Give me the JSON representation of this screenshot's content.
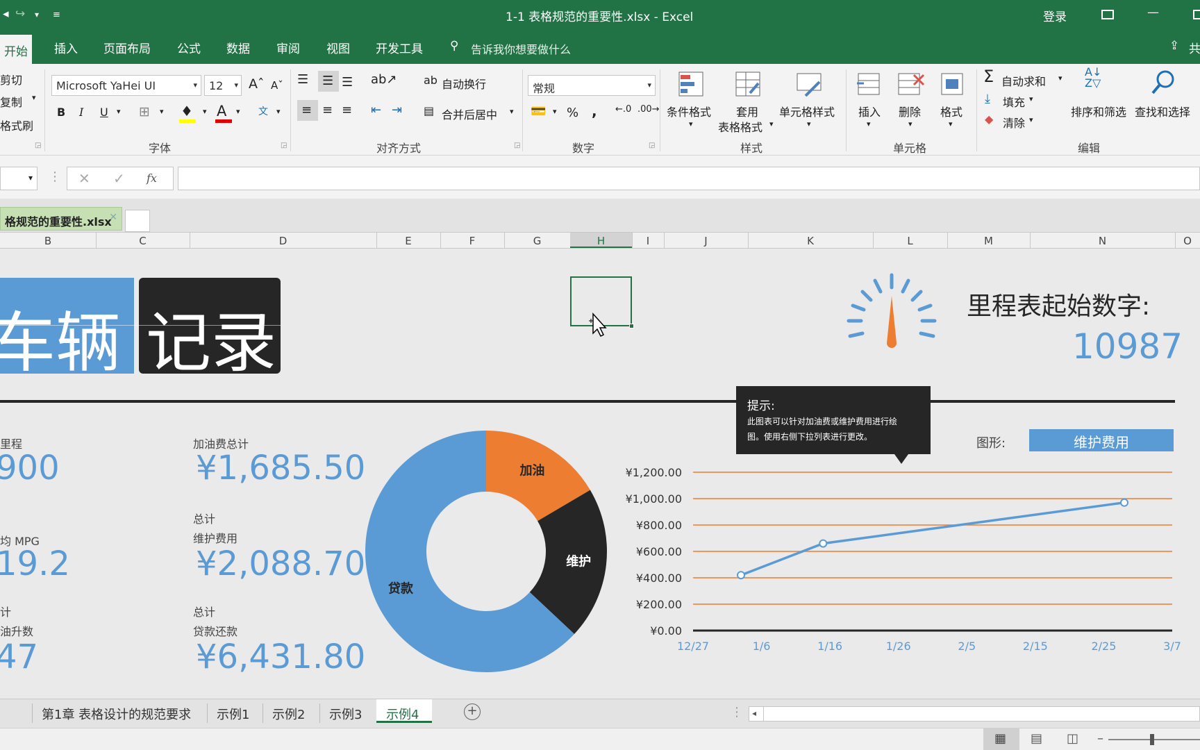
{
  "window": {
    "title": "1-1 表格规范的重要性.xlsx  -  Excel",
    "login": "登录"
  },
  "ribbon_tabs": [
    "开始",
    "插入",
    "页面布局",
    "公式",
    "数据",
    "审阅",
    "视图",
    "开发工具"
  ],
  "tell_me": "告诉我你想要做什么",
  "clipboard": {
    "cut": "剪切",
    "copy": "复制",
    "painter": "格式刷"
  },
  "font": {
    "name": "Microsoft YaHei UI",
    "size": "12",
    "group": "字体"
  },
  "alignment": {
    "wrap": "自动换行",
    "merge": "合并后居中",
    "group": "对齐方式"
  },
  "number": {
    "format": "常规",
    "group": "数字",
    "percent": "%",
    "comma": ","
  },
  "styles": {
    "conditional": "条件格式",
    "table_format_1": "套用",
    "table_format_2": "表格格式",
    "cell_styles": "单元格样式",
    "group": "样式"
  },
  "cells": {
    "insert": "插入",
    "delete": "删除",
    "format": "格式",
    "group": "单元格"
  },
  "editing": {
    "autosum": "自动求和",
    "fill": "填充",
    "clear": "清除",
    "sort": "排序和筛选",
    "find": "查找和选择",
    "group": "编辑"
  },
  "formula_bar": {
    "fx": "fx",
    "value": ""
  },
  "file_tab": "格规范的重要性.xlsx",
  "columns": [
    "B",
    "C",
    "D",
    "E",
    "F",
    "G",
    "H",
    "I",
    "J",
    "K",
    "L",
    "M",
    "N",
    "O"
  ],
  "sheet": {
    "title_left": "车辆",
    "title_right": "记录",
    "odometer_label": "里程表起始数字:",
    "odometer_value": "10987",
    "mileage_label": "里程",
    "mileage_value": "900",
    "avg_label": "均 MPG",
    "avg_value": "19.2",
    "total_label": "计",
    "gallons_label": "油升数",
    "gallons_value": "47",
    "fuel_label": "加油费总计",
    "fuel_value": "¥1,685.50",
    "maint_total": "总计",
    "maint_label": "维护费用",
    "maint_value": "¥2,088.70",
    "loan_total": "总计",
    "loan_label": "贷款还款",
    "loan_value": "¥6,431.80",
    "tip_title": "提示:",
    "tip_body_1": "此图表可以针对加油费或维护费用进行绘",
    "tip_body_2": "图。使用右侧下拉列表进行更改。",
    "chart_type_label": "图形:",
    "chart_type_value": "维护费用"
  },
  "chart_data": [
    {
      "type": "pie",
      "variant": "donut",
      "categories": [
        "加油",
        "维护",
        "贷款"
      ],
      "values": [
        1685.5,
        2088.7,
        6431.8
      ],
      "colors": [
        "#ed7d31",
        "#262626",
        "#5b9bd5"
      ]
    },
    {
      "type": "line",
      "x": [
        "1/3",
        "1/15",
        "2/28"
      ],
      "y": [
        420,
        660,
        970
      ],
      "xticks": [
        "12/27",
        "1/6",
        "1/16",
        "1/26",
        "2/5",
        "2/15",
        "2/25",
        "3/7"
      ],
      "yticks": [
        "¥0.00",
        "¥200.00",
        "¥400.00",
        "¥600.00",
        "¥800.00",
        "¥1,000.00",
        "¥1,200.00"
      ],
      "ylim": [
        0,
        1200
      ],
      "grid": true,
      "colors": {
        "line": "#5b9bd5",
        "grid": "#ed7d31"
      }
    }
  ],
  "sheet_tabs": [
    "第1章 表格设计的规范要求",
    "示例1",
    "示例2",
    "示例3",
    "示例4"
  ],
  "active_sheet": "示例4"
}
